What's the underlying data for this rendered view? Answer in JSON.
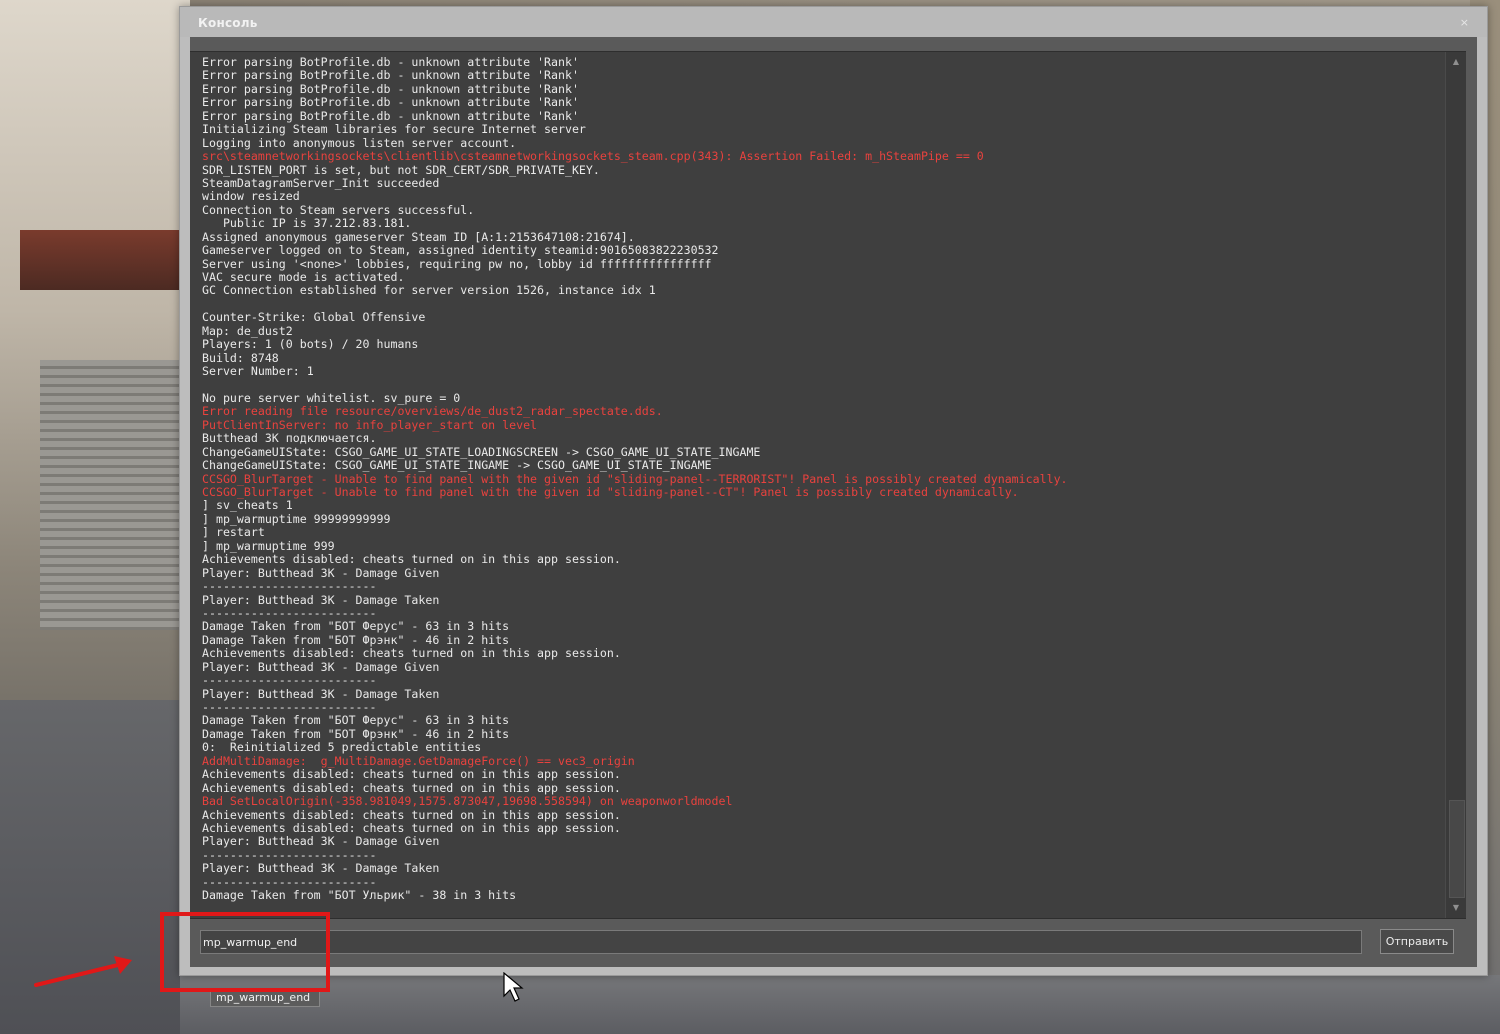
{
  "window": {
    "title": "Консоль",
    "close_glyph": "×"
  },
  "log": [
    {
      "text": "Error parsing BotProfile.db - unknown attribute 'Rank'",
      "error": false
    },
    {
      "text": "Error parsing BotProfile.db - unknown attribute 'Rank'",
      "error": false
    },
    {
      "text": "Error parsing BotProfile.db - unknown attribute 'Rank'",
      "error": false
    },
    {
      "text": "Error parsing BotProfile.db - unknown attribute 'Rank'",
      "error": false
    },
    {
      "text": "Error parsing BotProfile.db - unknown attribute 'Rank'",
      "error": false
    },
    {
      "text": "Initializing Steam libraries for secure Internet server",
      "error": false
    },
    {
      "text": "Logging into anonymous listen server account.",
      "error": false
    },
    {
      "text": "src\\steamnetworkingsockets\\clientlib\\csteamnetworkingsockets_steam.cpp(343): Assertion Failed: m_hSteamPipe == 0",
      "error": true
    },
    {
      "text": "SDR_LISTEN_PORT is set, but not SDR_CERT/SDR_PRIVATE_KEY.",
      "error": false
    },
    {
      "text": "SteamDatagramServer_Init succeeded",
      "error": false
    },
    {
      "text": "window resized",
      "error": false
    },
    {
      "text": "Connection to Steam servers successful.",
      "error": false
    },
    {
      "text": "   Public IP is 37.212.83.181.",
      "error": false
    },
    {
      "text": "Assigned anonymous gameserver Steam ID [A:1:2153647108:21674].",
      "error": false
    },
    {
      "text": "Gameserver logged on to Steam, assigned identity steamid:90165083822230532",
      "error": false
    },
    {
      "text": "Server using '<none>' lobbies, requiring pw no, lobby id ffffffffffffffff",
      "error": false
    },
    {
      "text": "VAC secure mode is activated.",
      "error": false
    },
    {
      "text": "GC Connection established for server version 1526, instance idx 1",
      "error": false
    },
    {
      "text": "",
      "error": false
    },
    {
      "text": "Counter-Strike: Global Offensive",
      "error": false
    },
    {
      "text": "Map: de_dust2",
      "error": false
    },
    {
      "text": "Players: 1 (0 bots) / 20 humans",
      "error": false
    },
    {
      "text": "Build: 8748",
      "error": false
    },
    {
      "text": "Server Number: 1",
      "error": false
    },
    {
      "text": "",
      "error": false
    },
    {
      "text": "No pure server whitelist. sv_pure = 0",
      "error": false
    },
    {
      "text": "Error reading file resource/overviews/de_dust2_radar_spectate.dds.",
      "error": true
    },
    {
      "text": "PutClientInServer: no info_player_start on level",
      "error": true
    },
    {
      "text": "Butthead 3K подключается.",
      "error": false
    },
    {
      "text": "ChangeGameUIState: CSGO_GAME_UI_STATE_LOADINGSCREEN -> CSGO_GAME_UI_STATE_INGAME",
      "error": false
    },
    {
      "text": "ChangeGameUIState: CSGO_GAME_UI_STATE_INGAME -> CSGO_GAME_UI_STATE_INGAME",
      "error": false
    },
    {
      "text": "CCSGO_BlurTarget - Unable to find panel with the given id \"sliding-panel--TERRORIST\"! Panel is possibly created dynamically.",
      "error": true
    },
    {
      "text": "CCSGO_BlurTarget - Unable to find panel with the given id \"sliding-panel--CT\"! Panel is possibly created dynamically.",
      "error": true
    },
    {
      "text": "] sv_cheats 1",
      "error": false
    },
    {
      "text": "] mp_warmuptime 99999999999",
      "error": false
    },
    {
      "text": "] restart",
      "error": false
    },
    {
      "text": "] mp_warmuptime 999",
      "error": false
    },
    {
      "text": "Achievements disabled: cheats turned on in this app session.",
      "error": false
    },
    {
      "text": "Player: Butthead 3K - Damage Given",
      "error": false
    },
    {
      "text": "-------------------------",
      "error": false
    },
    {
      "text": "Player: Butthead 3K - Damage Taken",
      "error": false
    },
    {
      "text": "-------------------------",
      "error": false
    },
    {
      "text": "Damage Taken from \"БОТ Ферус\" - 63 in 3 hits",
      "error": false
    },
    {
      "text": "Damage Taken from \"БОТ Фрэнк\" - 46 in 2 hits",
      "error": false
    },
    {
      "text": "Achievements disabled: cheats turned on in this app session.",
      "error": false
    },
    {
      "text": "Player: Butthead 3K - Damage Given",
      "error": false
    },
    {
      "text": "-------------------------",
      "error": false
    },
    {
      "text": "Player: Butthead 3K - Damage Taken",
      "error": false
    },
    {
      "text": "-------------------------",
      "error": false
    },
    {
      "text": "Damage Taken from \"БОТ Ферус\" - 63 in 3 hits",
      "error": false
    },
    {
      "text": "Damage Taken from \"БОТ Фрэнк\" - 46 in 2 hits",
      "error": false
    },
    {
      "text": "0:  Reinitialized 5 predictable entities",
      "error": false
    },
    {
      "text": "AddMultiDamage:  g_MultiDamage.GetDamageForce() == vec3_origin",
      "error": true
    },
    {
      "text": "Achievements disabled: cheats turned on in this app session.",
      "error": false
    },
    {
      "text": "Achievements disabled: cheats turned on in this app session.",
      "error": false
    },
    {
      "text": "Bad SetLocalOrigin(-358.981049,1575.873047,19698.558594) on weaponworldmodel",
      "error": true
    },
    {
      "text": "Achievements disabled: cheats turned on in this app session.",
      "error": false
    },
    {
      "text": "Achievements disabled: cheats turned on in this app session.",
      "error": false
    },
    {
      "text": "Player: Butthead 3K - Damage Given",
      "error": false
    },
    {
      "text": "-------------------------",
      "error": false
    },
    {
      "text": "Player: Butthead 3K - Damage Taken",
      "error": false
    },
    {
      "text": "-------------------------",
      "error": false
    },
    {
      "text": "Damage Taken from \"БОТ Ульрик\" - 38 in 3 hits",
      "error": false
    }
  ],
  "input": {
    "value": "mp_warmup_end",
    "send_label": "Отправить"
  },
  "autocomplete": {
    "suggestion": "mp_warmup_end"
  },
  "scrollbar": {
    "up_glyph": "▲",
    "down_glyph": "▼"
  },
  "colors": {
    "error_text": "#e8423e",
    "normal_text": "#e9e9e9",
    "highlight": "#e01818"
  }
}
